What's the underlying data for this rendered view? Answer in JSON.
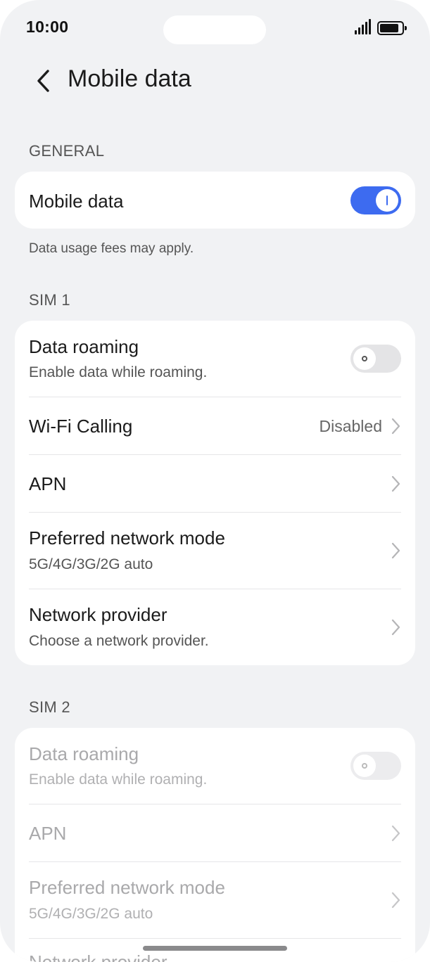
{
  "status_bar": {
    "time": "10:00"
  },
  "header": {
    "title": "Mobile data"
  },
  "general": {
    "label": "GENERAL",
    "mobile_data": {
      "title": "Mobile data",
      "enabled": true
    },
    "note": "Data usage fees may apply."
  },
  "sim1": {
    "label": "SIM 1",
    "data_roaming": {
      "title": "Data roaming",
      "subtitle": "Enable data while roaming.",
      "enabled": false
    },
    "wifi_calling": {
      "title": "Wi-Fi Calling",
      "value": "Disabled"
    },
    "apn": {
      "title": "APN"
    },
    "preferred_network": {
      "title": "Preferred network mode",
      "subtitle": "5G/4G/3G/2G auto"
    },
    "network_provider": {
      "title": "Network provider",
      "subtitle": "Choose a network provider."
    }
  },
  "sim2": {
    "label": "SIM 2",
    "data_roaming": {
      "title": "Data roaming",
      "subtitle": "Enable data while roaming.",
      "enabled": false
    },
    "apn": {
      "title": "APN"
    },
    "preferred_network": {
      "title": "Preferred network mode",
      "subtitle": "5G/4G/3G/2G auto"
    },
    "network_provider": {
      "title": "Network provider"
    }
  },
  "colors": {
    "accent": "#3d6bf0",
    "background": "#f1f2f4",
    "card": "#ffffff"
  }
}
